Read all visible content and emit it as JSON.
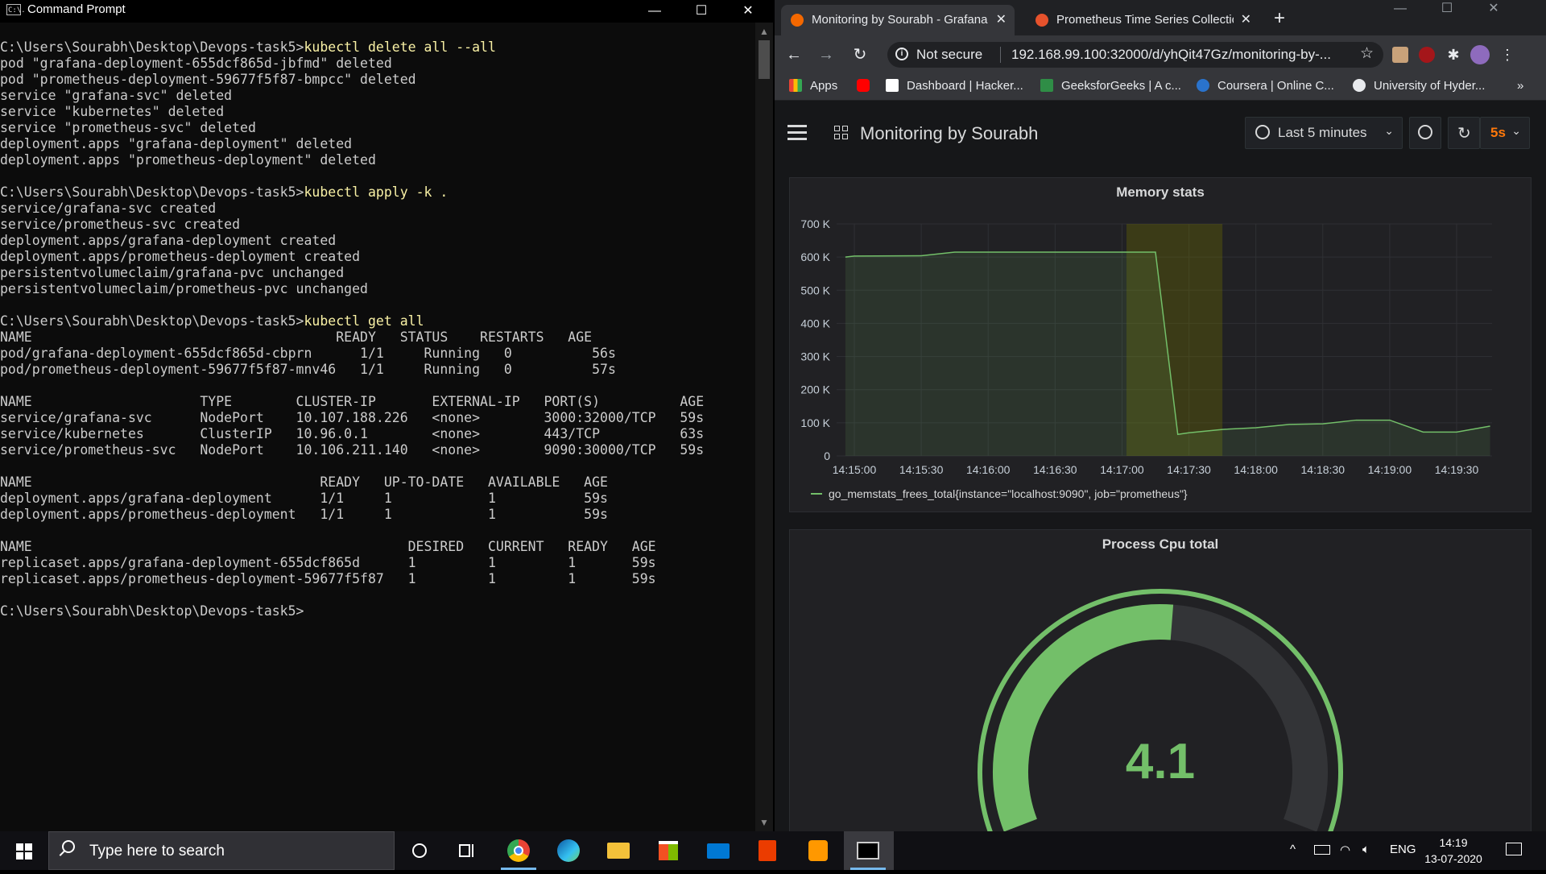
{
  "cmd": {
    "title": "Command Prompt",
    "icon_text": "C:\\.",
    "controls": {
      "minimize": "—",
      "maximize": "☐",
      "close": "✕"
    },
    "lines": [
      {
        "prompt": "C:\\Users\\Sourabh\\Desktop\\Devops-task5>",
        "cmd": "kubectl delete all --all"
      },
      {
        "text": "pod \"grafana-deployment-655dcf865d-jbfmd\" deleted"
      },
      {
        "text": "pod \"prometheus-deployment-59677f5f87-bmpcc\" deleted"
      },
      {
        "text": "service \"grafana-svc\" deleted"
      },
      {
        "text": "service \"kubernetes\" deleted"
      },
      {
        "text": "service \"prometheus-svc\" deleted"
      },
      {
        "text": "deployment.apps \"grafana-deployment\" deleted"
      },
      {
        "text": "deployment.apps \"prometheus-deployment\" deleted"
      },
      {
        "text": ""
      },
      {
        "prompt": "C:\\Users\\Sourabh\\Desktop\\Devops-task5>",
        "cmd": "kubectl apply -k ."
      },
      {
        "text": "service/grafana-svc created"
      },
      {
        "text": "service/prometheus-svc created"
      },
      {
        "text": "deployment.apps/grafana-deployment created"
      },
      {
        "text": "deployment.apps/prometheus-deployment created"
      },
      {
        "text": "persistentvolumeclaim/grafana-pvc unchanged"
      },
      {
        "text": "persistentvolumeclaim/prometheus-pvc unchanged"
      },
      {
        "text": ""
      },
      {
        "prompt": "C:\\Users\\Sourabh\\Desktop\\Devops-task5>",
        "cmd": "kubectl get all"
      },
      {
        "text": "NAME                                      READY   STATUS    RESTARTS   AGE"
      },
      {
        "text": "pod/grafana-deployment-655dcf865d-cbprn      1/1     Running   0          56s"
      },
      {
        "text": "pod/prometheus-deployment-59677f5f87-mnv46   1/1     Running   0          57s"
      },
      {
        "text": ""
      },
      {
        "text": "NAME                     TYPE        CLUSTER-IP       EXTERNAL-IP   PORT(S)          AGE"
      },
      {
        "text": "service/grafana-svc      NodePort    10.107.188.226   <none>        3000:32000/TCP   59s"
      },
      {
        "text": "service/kubernetes       ClusterIP   10.96.0.1        <none>        443/TCP          63s"
      },
      {
        "text": "service/prometheus-svc   NodePort    10.106.211.140   <none>        9090:30000/TCP   59s"
      },
      {
        "text": ""
      },
      {
        "text": "NAME                                    READY   UP-TO-DATE   AVAILABLE   AGE"
      },
      {
        "text": "deployment.apps/grafana-deployment      1/1     1            1           59s"
      },
      {
        "text": "deployment.apps/prometheus-deployment   1/1     1            1           59s"
      },
      {
        "text": ""
      },
      {
        "text": "NAME                                               DESIRED   CURRENT   READY   AGE"
      },
      {
        "text": "replicaset.apps/grafana-deployment-655dcf865d      1         1         1       59s"
      },
      {
        "text": "replicaset.apps/prometheus-deployment-59677f5f87   1         1         1       59s"
      },
      {
        "text": ""
      },
      {
        "prompt": "C:\\Users\\Sourabh\\Desktop\\Devops-task5>",
        "cmd": ""
      }
    ]
  },
  "browser": {
    "tabs": [
      {
        "title": "Monitoring by Sourabh - Grafana",
        "favicon_color": "#f46800",
        "active": true
      },
      {
        "title": "Prometheus Time Series Collectio",
        "favicon_color": "#e6522c",
        "active": false
      }
    ],
    "new_tab": "+",
    "window_controls": {
      "minimize": "—",
      "maximize": "☐",
      "close": "✕"
    },
    "nav": {
      "back": "←",
      "forward": "→",
      "reload": "↻"
    },
    "address": {
      "security": "Not secure",
      "url": "192.168.99.100:32000/d/yhQit47Gz/monitoring-by-...",
      "star": "☆"
    },
    "bookmarks": [
      {
        "label": "Apps",
        "icon": "apps-grid-icon",
        "color": "#4285f4"
      },
      {
        "label": "",
        "icon": "youtube-icon",
        "color": "#ff0000"
      },
      {
        "label": "Dashboard | Hacker...",
        "icon": "hackerrank-icon",
        "color": "#ffffff"
      },
      {
        "label": "GeeksforGeeks | A c...",
        "icon": "geeksforgeeks-icon",
        "color": "#2f8d46"
      },
      {
        "label": "Coursera | Online C...",
        "icon": "coursera-icon",
        "color": "#2a73cc"
      },
      {
        "label": "University of Hyder...",
        "icon": "globe-icon",
        "color": "#e8eaed"
      }
    ],
    "bookmarks_more": "»"
  },
  "grafana": {
    "dashboard_title": "Monitoring by Sourabh",
    "time_range": "Last 5 minutes",
    "refresh_interval": "5s",
    "accent": "#73bf69",
    "panels": [
      {
        "title": "Memory stats"
      },
      {
        "title": "Process Cpu total",
        "gauge_value": "4.1"
      }
    ]
  },
  "chart_data": [
    {
      "type": "line",
      "title": "Memory stats",
      "x": [
        "14:14:56",
        "14:15:00",
        "14:15:30",
        "14:15:45",
        "14:16:00",
        "14:16:30",
        "14:17:00",
        "14:17:15",
        "14:17:25",
        "14:17:30",
        "14:17:45",
        "14:18:00",
        "14:18:15",
        "14:18:30",
        "14:18:45",
        "14:19:00",
        "14:19:15",
        "14:19:30",
        "14:19:45"
      ],
      "series": [
        {
          "name": "go_memstats_frees_total{instance=\"localhost:9090\", job=\"prometheus\"}",
          "color": "#73bf69",
          "values": [
            600000,
            603000,
            604000,
            615000,
            615000,
            615000,
            615000,
            615000,
            65000,
            70000,
            80000,
            85000,
            95000,
            97000,
            108000,
            108000,
            72000,
            72000,
            90000
          ]
        }
      ],
      "xticks": [
        "14:15:00",
        "14:15:30",
        "14:16:00",
        "14:16:30",
        "14:17:00",
        "14:17:30",
        "14:18:00",
        "14:18:30",
        "14:19:00",
        "14:19:30"
      ],
      "yticks": [
        "0",
        "100 K",
        "200 K",
        "300 K",
        "400 K",
        "500 K",
        "600 K",
        "700 K"
      ],
      "ylim": [
        0,
        700000
      ],
      "legend_placement": "bottom-left",
      "grid": true
    },
    {
      "type": "gauge",
      "title": "Process Cpu total",
      "value": 4.1,
      "fill_fraction": 0.52,
      "color": "#73bf69"
    }
  ],
  "taskbar": {
    "search_placeholder": "Type here to search",
    "apps": [
      "cortana-icon",
      "task-view-icon",
      "chrome-icon",
      "edge-icon",
      "file-explorer-icon",
      "store-icon",
      "mail-icon",
      "office-icon",
      "sublime-icon",
      "terminal-icon"
    ],
    "tray": {
      "chevron": "^",
      "lang": "ENG",
      "time": "14:19",
      "date": "13-07-2020"
    }
  }
}
